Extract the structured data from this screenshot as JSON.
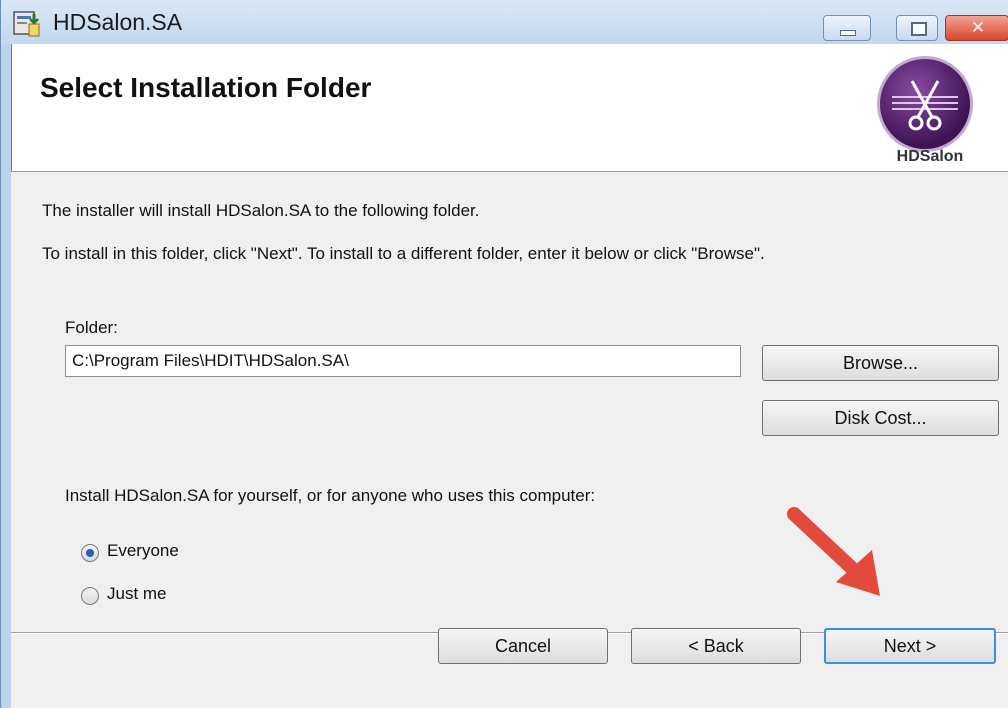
{
  "window": {
    "title": "HDSalon.SA",
    "controls": {
      "minimize_icon": "minimize-icon",
      "maximize_icon": "maximize-icon",
      "close_glyph": "✕"
    }
  },
  "banner": {
    "title": "Select Installation Folder",
    "logo_label": "HDSalon",
    "logo_icon": "scissors-logo"
  },
  "body": {
    "line1": "The installer will install HDSalon.SA to the following folder.",
    "line2": "To install in this folder, click \"Next\". To install to a different folder, enter it below or click \"Browse\".",
    "folder_label": "Folder:",
    "folder_value": "C:\\Program Files\\HDIT\\HDSalon.SA\\",
    "browse_label": "Browse...",
    "disk_cost_label": "Disk Cost...",
    "install_for": "Install HDSalon.SA for yourself, or for anyone who uses this computer:",
    "options": [
      {
        "label": "Everyone",
        "checked": true
      },
      {
        "label": "Just me",
        "checked": false
      }
    ]
  },
  "footer": {
    "cancel_label": "Cancel",
    "back_label": "< Back",
    "next_label": "Next >"
  },
  "colors": {
    "accent_arrow": "#e24a3b",
    "next_focus": "#3d8ee6",
    "radio_dot": "#2a5fb0"
  }
}
